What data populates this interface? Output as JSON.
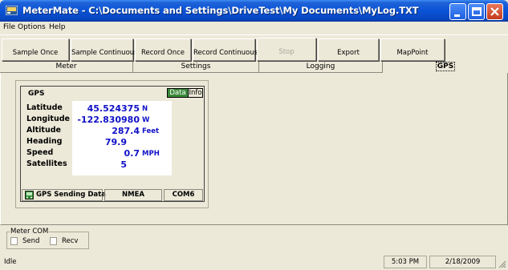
{
  "window": {
    "title": "MeterMate - C:\\Documents and Settings\\DriveTest\\My Documents\\MyLog.TXT"
  },
  "menu": [
    "File",
    "Options",
    "Help"
  ],
  "toolbar": {
    "sample_once": "Sample Once",
    "sample_continuous": "Sample Continuous",
    "record_once": "Record Once",
    "record_continuous": "Record Continuous",
    "stop": "Stop",
    "export": "Export",
    "mappoint": "MapPoint"
  },
  "tabs": [
    "Meter",
    "Settings",
    "Logging",
    "GPS"
  ],
  "gps": {
    "title": "GPS",
    "data_button": "Data",
    "info_button": "Info",
    "rows": [
      {
        "label": "Latitude",
        "value": "45.524375",
        "unit": "N"
      },
      {
        "label": "Longitude",
        "value": "-122.830980",
        "unit": "W"
      },
      {
        "label": "Altitude",
        "value": "287.4",
        "unit": "Feet"
      },
      {
        "label": "Heading",
        "value": "79.9",
        "unit": ""
      },
      {
        "label": "Speed",
        "value": "0.7",
        "unit": "MPH"
      },
      {
        "label": "Satellites",
        "value": "5",
        "unit": ""
      }
    ],
    "status": "GPS Sending Data",
    "protocol": "NMEA",
    "port": "COM6"
  },
  "meter_com": {
    "title": "Meter COM",
    "send": "Send",
    "recv": "Recv"
  },
  "statusbar": {
    "state": "Idle",
    "time": "5:03 PM",
    "date": "2/18/2009"
  },
  "colors": {
    "titlebar": "#0a53d6",
    "value_text": "#1010c8",
    "data_button": "#3a8a3a"
  }
}
